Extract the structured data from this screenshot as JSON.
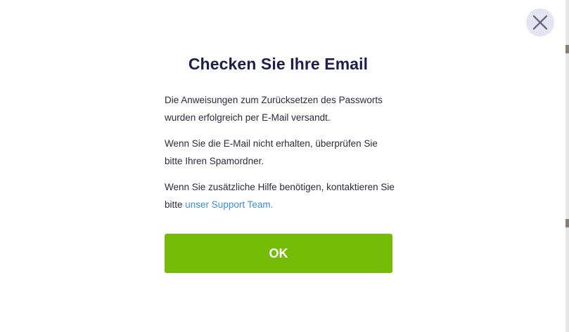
{
  "dialog": {
    "title": "Checken Sie Ihre Email",
    "paragraph_1": "Die Anweisungen zum Zurücksetzen des Passworts wurden erfolgreich per E-Mail versandt.",
    "paragraph_2": "Wenn Sie die E-Mail nicht erhalten, überprüfen Sie bitte Ihren Spamordner.",
    "paragraph_3_prefix": "Wenn Sie zusätzliche Hilfe benötigen, kontaktieren Sie bitte ",
    "support_link": "unser Support Team.",
    "ok_label": "OK",
    "close_icon": "close-icon"
  },
  "colors": {
    "title": "#1b1f4a",
    "text": "#2b2b3a",
    "link": "#3b8fd6",
    "ok_button": "#76bb07",
    "close_bg": "#e4e4f1",
    "close_icon": "#5a5f7a"
  }
}
